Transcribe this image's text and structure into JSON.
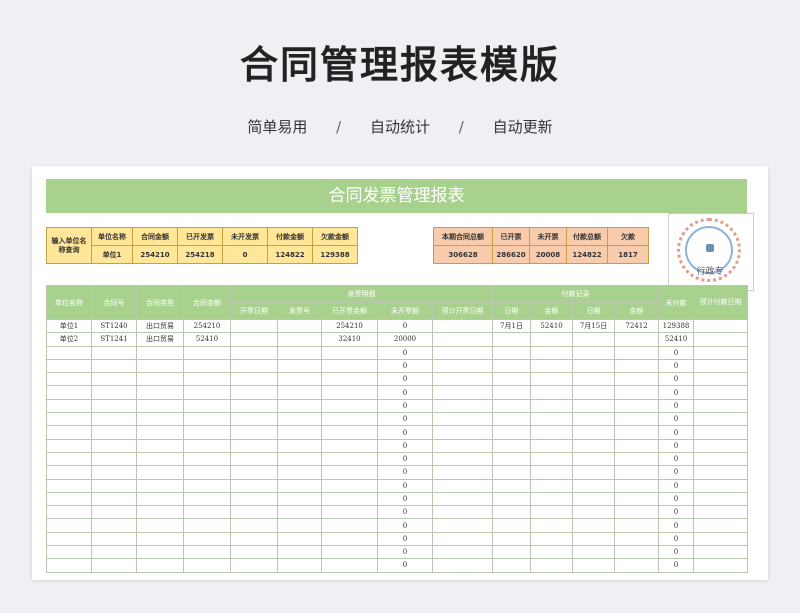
{
  "header": {
    "title": "合同管理报表模版",
    "features": [
      "简单易用",
      "自动统计",
      "自动更新"
    ],
    "separator": "/"
  },
  "sheet": {
    "banner": "合同发票管理报表",
    "summary_left": {
      "row_label": "输入单位名称查询",
      "headers": [
        "单位名称",
        "合同金额",
        "已开发票",
        "未开发票",
        "付款金额",
        "欠款金额"
      ],
      "values": [
        "单位1",
        "254210",
        "254218",
        "0",
        "124822",
        "129388"
      ]
    },
    "summary_right": {
      "headers": [
        "本期合同总额",
        "已开票",
        "未开票",
        "付款总额",
        "欠款"
      ],
      "values": [
        "306628",
        "286620",
        "20008",
        "124822",
        "1817"
      ]
    },
    "stamp_text": "行政专",
    "table": {
      "fixed_headers": [
        "单位名称",
        "合同号",
        "合同类型",
        "合同金额"
      ],
      "group_invoice": "发票明细",
      "invoice_headers": [
        "开票日期",
        "发票号",
        "已开票金额",
        "未开票额",
        "预计开票日期"
      ],
      "group_payment": "付款记录",
      "payment_headers": [
        "日期",
        "金额",
        "日期",
        "金额"
      ],
      "tail_headers": [
        "未付款",
        "预计付款日期"
      ],
      "rows": [
        [
          "单位1",
          "ST1240",
          "出口贸易",
          "254210",
          "",
          "",
          "254210",
          "0",
          "",
          "7月1日",
          "52410",
          "7月15日",
          "72412",
          "129388",
          ""
        ],
        [
          "单位2",
          "ST1241",
          "出口贸易",
          "52410",
          "",
          "",
          "32410",
          "20000",
          "",
          "",
          "",
          "",
          "",
          "52410",
          ""
        ]
      ],
      "empty_row_zero": "0"
    }
  }
}
